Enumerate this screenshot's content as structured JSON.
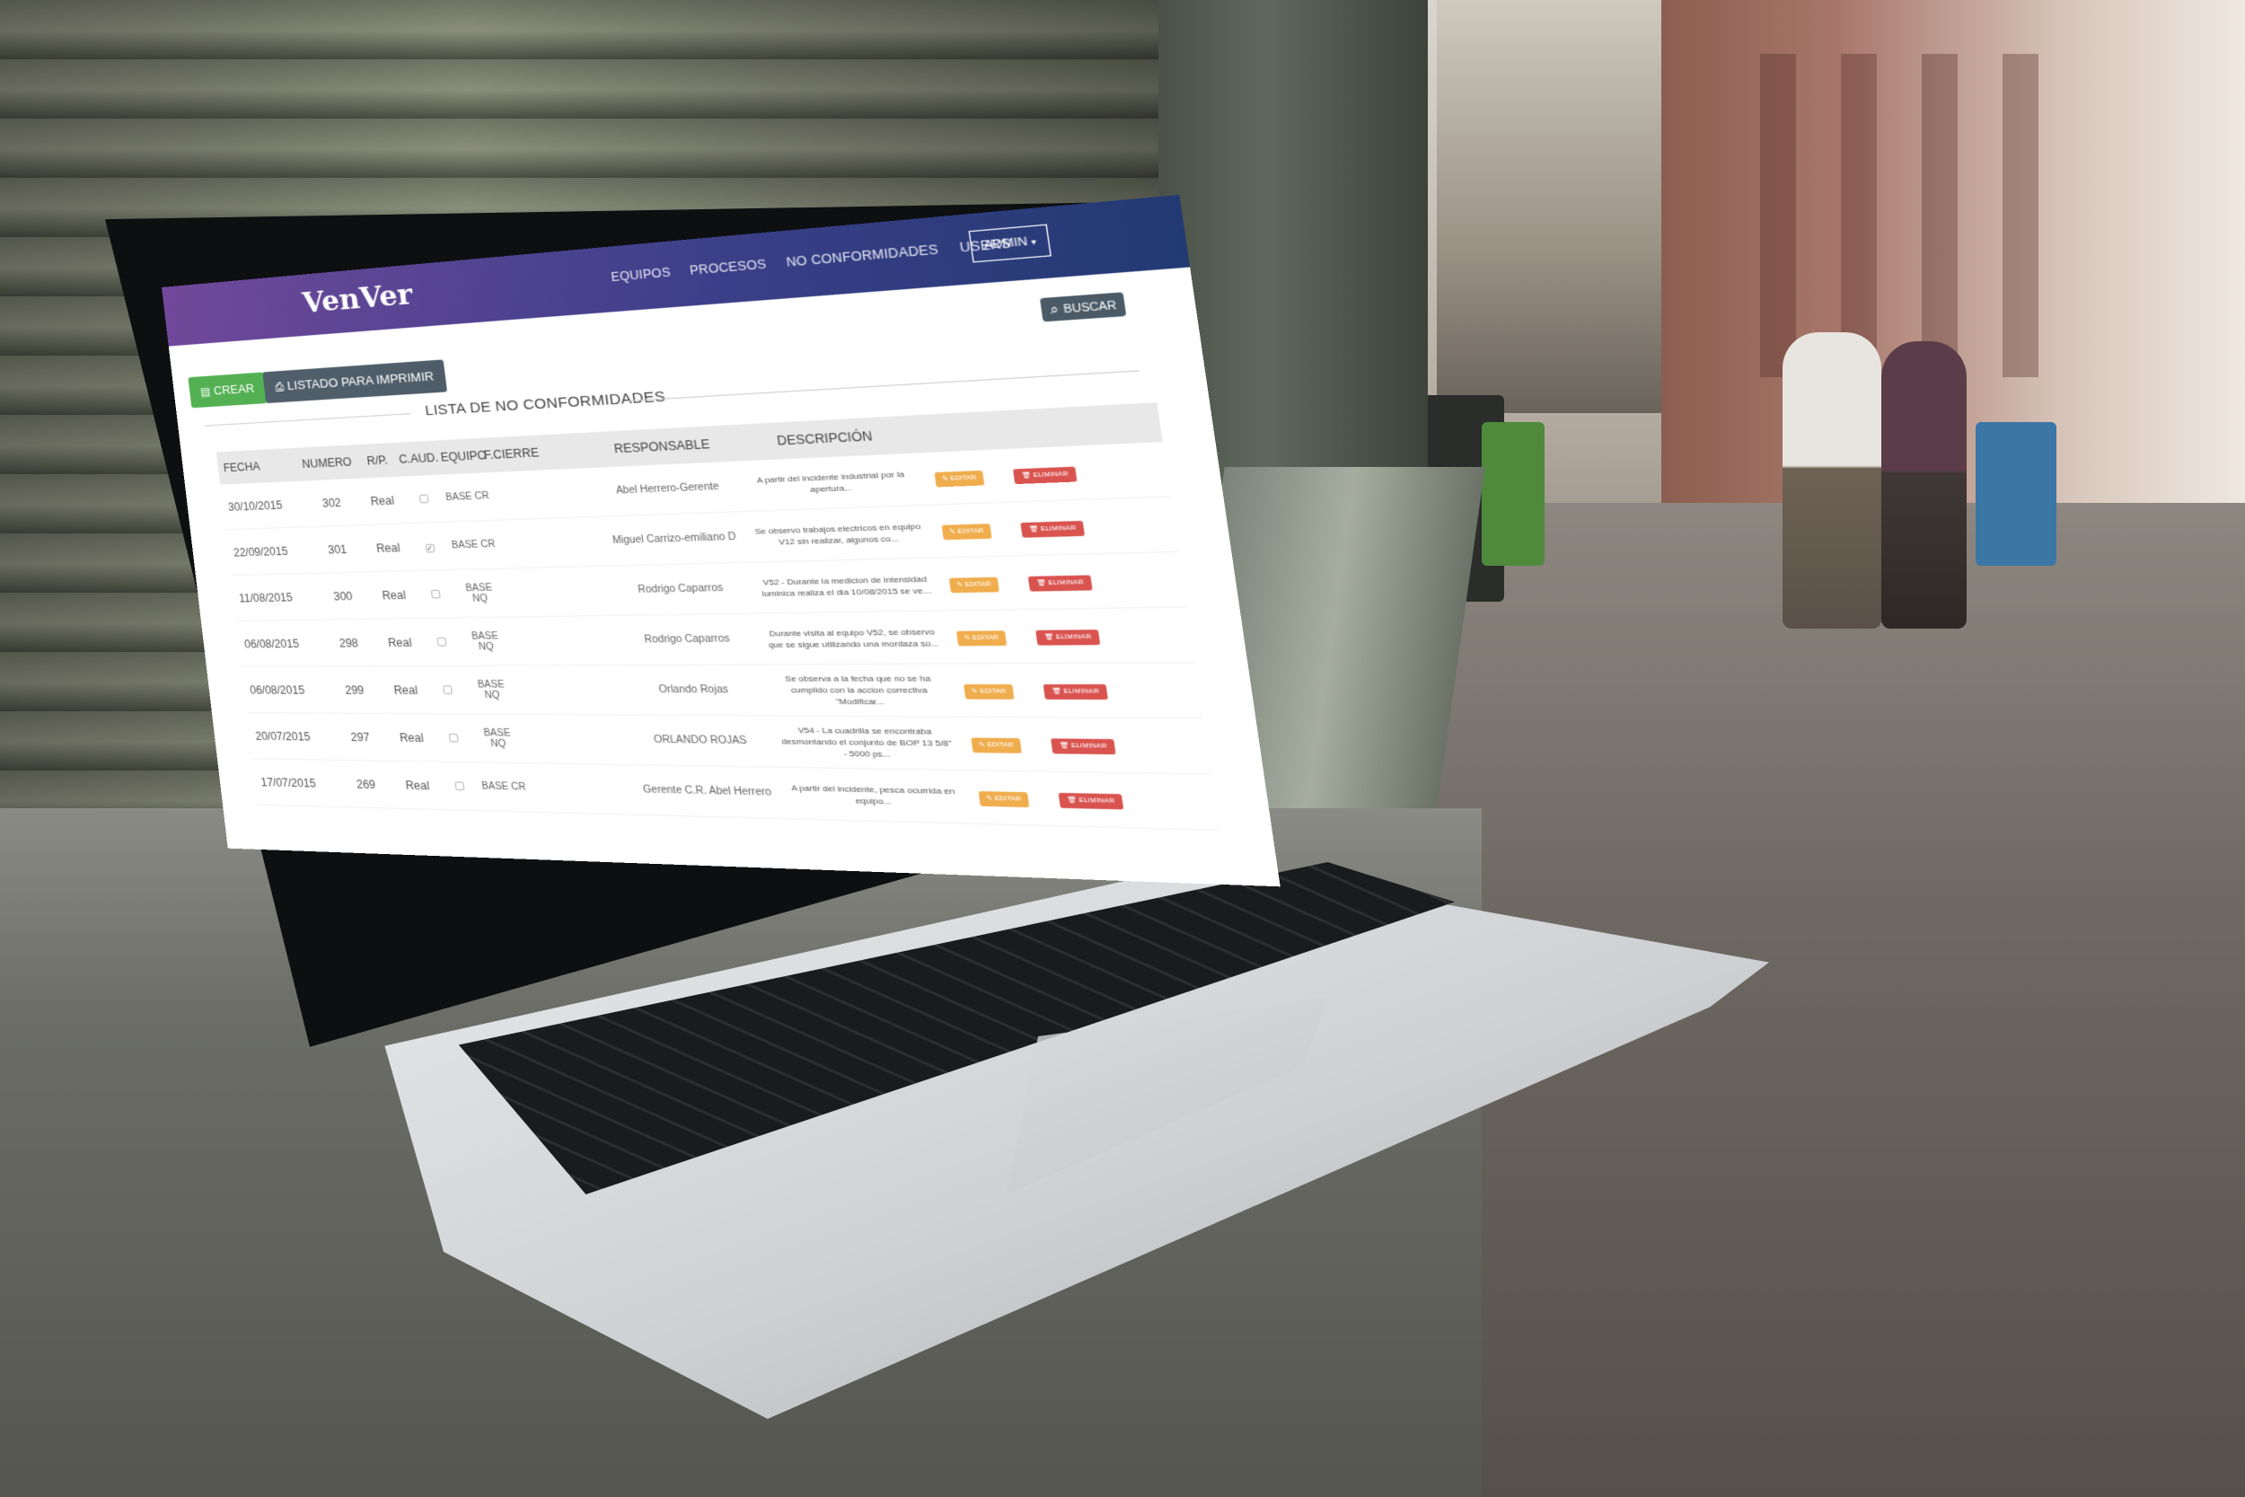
{
  "brand": "VenVer",
  "nav": {
    "links": [
      "EQUIPOS",
      "PROCESOS",
      "NO CONFORMIDADES",
      "USERS"
    ],
    "admin_label": "ADMIN"
  },
  "toolbar": {
    "crear_label": "CREAR",
    "listado_label": "LISTADO PARA IMPRIMIR",
    "buscar_label": "BUSCAR"
  },
  "section_title": "LISTA DE NO CONFORMIDADES",
  "table": {
    "headers": [
      "FECHA",
      "NUMERO",
      "R/P.",
      "C.AUD.",
      "EQUIPO",
      "F.CIERRE",
      "RESPONSABLE",
      "DESCRIPCIÓN"
    ],
    "rows": [
      {
        "fecha": "30/10/2015",
        "numero": "302",
        "rp": "Real",
        "caud": false,
        "equipo": "BASE CR",
        "responsable": "Abel Herrero-Gerente",
        "descripcion": "A partir del incidente industrial por la apertura..."
      },
      {
        "fecha": "22/09/2015",
        "numero": "301",
        "rp": "Real",
        "caud": true,
        "equipo": "BASE CR",
        "responsable": "Miguel Carrizo-emiliano D",
        "descripcion": "Se observo trabajos electricos en equipo V12 sin realizar, algunos co..."
      },
      {
        "fecha": "11/08/2015",
        "numero": "300",
        "rp": "Real",
        "caud": false,
        "equipo": "BASE NQ",
        "responsable": "Rodrigo Caparros",
        "descripcion": "V52 - Durante la medicion de intensidad luminica realiza el dia 10/08/2015 se ve..."
      },
      {
        "fecha": "06/08/2015",
        "numero": "298",
        "rp": "Real",
        "caud": false,
        "equipo": "BASE NQ",
        "responsable": "Rodrigo Caparros",
        "descripcion": "Durante visita al equipo V52, se observo que se sigue utilizando una mordaza so..."
      },
      {
        "fecha": "06/08/2015",
        "numero": "299",
        "rp": "Real",
        "caud": false,
        "equipo": "BASE NQ",
        "responsable": "Orlando Rojas",
        "descripcion": "Se observa a la fecha que no se ha cumplido con la accion correctiva \"Modificar..."
      },
      {
        "fecha": "20/07/2015",
        "numero": "297",
        "rp": "Real",
        "caud": false,
        "equipo": "BASE NQ",
        "responsable": "ORLANDO ROJAS",
        "descripcion": "V54 - La cuadrilla se encontraba desmontando el conjunto de BOP 13 5/8\" - 5000 ps..."
      },
      {
        "fecha": "17/07/2015",
        "numero": "269",
        "rp": "Real",
        "caud": false,
        "equipo": "BASE CR",
        "responsable": "Gerente C.R. Abel Herrero",
        "descripcion": "A partir del incidente, pesca ocurrida en equipo..."
      }
    ],
    "edit_label": "EDITAR",
    "delete_label": "ELIMINAR"
  },
  "colors": {
    "nav_gradient_start": "#6a3f96",
    "nav_gradient_end": "#223a73",
    "crear": "#4cae4c",
    "dark_button": "#4a5a66",
    "editar": "#f0ad4e",
    "eliminar": "#d9534f"
  },
  "icons": {
    "crear": "file-icon",
    "listado": "printer-icon",
    "buscar": "search-icon",
    "editar": "edit-icon",
    "eliminar": "trash-icon"
  }
}
